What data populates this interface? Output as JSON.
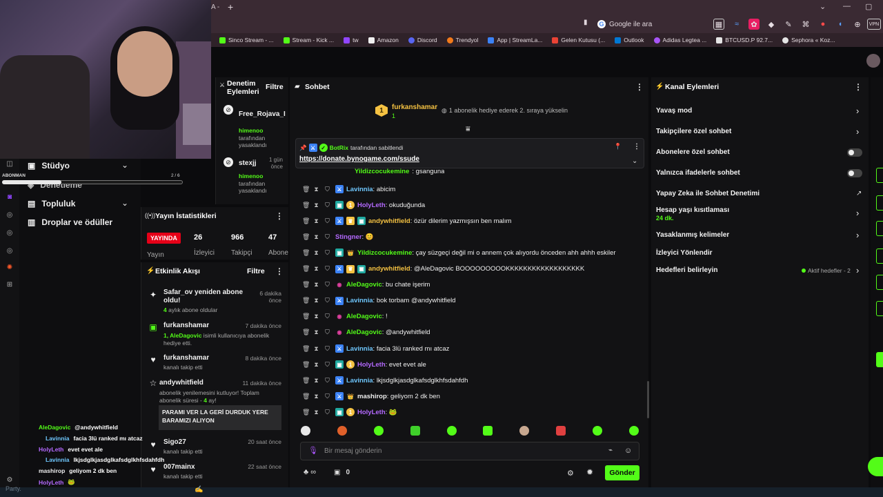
{
  "browser": {
    "tab_fragment": "A -",
    "new_tab": "+",
    "search_placeholder": "Google ile ara",
    "bookmarks": [
      {
        "label": "Sinco Stream - ...",
        "color": "#53fc18"
      },
      {
        "label": "Stream - Kick ...",
        "color": "#53fc18"
      },
      {
        "label": "tw",
        "color": "#9146ff"
      },
      {
        "label": "Amazon",
        "color": "#f0f0f0"
      },
      {
        "label": "Discord",
        "color": "#5865f2"
      },
      {
        "label": "Trendyol",
        "color": "#f27a1a"
      },
      {
        "label": "App | StreamLa...",
        "color": "#3b82f6"
      },
      {
        "label": "Gelen Kutusu (...",
        "color": "#ea4335"
      },
      {
        "label": "Outlook",
        "color": "#0078d4"
      },
      {
        "label": "Adidas Legtea ...",
        "color": "#a855f7"
      },
      {
        "label": "BTCUSD.P 92.7...",
        "color": "#e5e5e5"
      },
      {
        "label": "Sephora « Koz...",
        "color": "#e5e5e5"
      }
    ]
  },
  "sidebar": {
    "studio": "Stüdyo",
    "moderation": "Denetleme",
    "community": "Topluluk",
    "drops": "Droplar ve ödüller"
  },
  "sub_goal": {
    "label": "ABONMAN",
    "value": "2 / 6",
    "progress": 0.33
  },
  "mod_actions": {
    "title": "Denetim Eylemleri",
    "filter": "Filtre",
    "items": [
      {
        "user": "Free_Rojava_I",
        "by": "himenoo",
        "by_text": "tarafından yasaklandı",
        "time": ""
      },
      {
        "user": "stexjj",
        "by": "himenoo",
        "by_text": "tarafından yasaklandı",
        "time": "1 gün önce"
      }
    ]
  },
  "stats": {
    "title": "Yayın İstatistikleri",
    "live": "YAYINDA",
    "live_label": "Yayın",
    "viewers": "26",
    "viewers_label": "İzleyici",
    "followers": "966",
    "followers_label": "Takipçi",
    "subs": "47",
    "subs_label": "Abone"
  },
  "activity": {
    "title": "Etkinlik Akışı",
    "filter": "Filtre",
    "items": [
      {
        "icon": "✦",
        "title": "Safar_ov yeniden abone oldu!",
        "sub_b": "4",
        "sub": " aylık abone oldular",
        "time": "6 dakika önce"
      },
      {
        "icon": "▣",
        "title": "furkanshamar",
        "sub_b": "1, AleDagovic",
        "sub": " isimli kullanıcıya abonelik hediye etti.",
        "time": "7 dakika önce"
      },
      {
        "icon": "♥",
        "title": "furkanshamar",
        "sub_b": "",
        "sub": "kanalı takip etti",
        "time": "8 dakika önce"
      },
      {
        "icon": "☆",
        "title": "andywhitfield",
        "sub_b": "",
        "sub": "abonelik yenilemesini kutluyor! Toplam abonelik süresi - ",
        "sub_b2": "4",
        "sub2": " ay!",
        "time": "11 dakika önce"
      },
      {
        "icon": "♥",
        "title": "Sigo27",
        "sub_b": "",
        "sub": "kanalı takip etti",
        "time": "20 saat önce"
      },
      {
        "icon": "♥",
        "title": "007mainx",
        "sub_b": "",
        "sub": "kanalı takip etti",
        "time": "22 saat önce"
      }
    ],
    "quote": "PARAMI VER LA GERİ DURDUK YERE BARAMIZI ALIYON"
  },
  "chat": {
    "title": "Sohbet",
    "gift_user": "furkanshamar",
    "gift_count": "1",
    "gift_text": "1 abonelik hediye ederek 2. sıraya yükselin",
    "pinned_by": "BotRix",
    "pinned_text": "tarafından sabitlendi",
    "pinned_link": "https://donate.bynogame.com/ssude",
    "partial_user": "Yildizcocukemine",
    "partial_text": ": gsanguna",
    "messages": [
      {
        "user": "Lavinnia",
        "color": "#6fc8ff",
        "text": ": abicim"
      },
      {
        "user": "HolyLeth",
        "color": "#b469ff",
        "text": ": okuduğunda"
      },
      {
        "user": "andywhitfield",
        "color": "#f5c242",
        "text": ": özür dilerim yazmışsın ben malım"
      },
      {
        "user": "Stingner",
        "color": "#b469ff",
        "text": ": 😊"
      },
      {
        "user": "Yildizcocukemine",
        "color": "#53fc18",
        "text": ": çay süzgeçi değil mi o annem çok alıyordu önceden ahh ahhh eskiler"
      },
      {
        "user": "andywhitfield",
        "color": "#f5c242",
        "text": ": @AleDagovic BOOOOOOOOOKKKKKKKKKKKKKKKKKK"
      },
      {
        "user": "AleDagovic",
        "color": "#53fc18",
        "text": ": bu chate işerim"
      },
      {
        "user": "Lavinnia",
        "color": "#6fc8ff",
        "text": ": bok torbam @andywhitfield"
      },
      {
        "user": "AleDagovic",
        "color": "#53fc18",
        "text": ": !"
      },
      {
        "user": "AleDagovic",
        "color": "#53fc18",
        "text": ": @andywhitfield"
      },
      {
        "user": "Lavinnia",
        "color": "#6fc8ff",
        "text": ": facia 3lü ranked mı atcaz"
      },
      {
        "user": "HolyLeth",
        "color": "#b469ff",
        "text": ": evet evet ale"
      },
      {
        "user": "Lavinnia",
        "color": "#6fc8ff",
        "text": ": lkjsdglkjasdglkafsdglkhfsdahfdh"
      },
      {
        "user": "mashirop",
        "color": "#f0f0f0",
        "text": ": geliyom 2 dk ben"
      },
      {
        "user": "HolyLeth",
        "color": "#b469ff",
        "text": ": 🐸"
      }
    ],
    "input_placeholder": "Bir mesaj gönderin",
    "infinity": "∞",
    "count": "0",
    "send": "Gönder"
  },
  "channel": {
    "title": "Kanal Eylemleri",
    "slow": "Yavaş mod",
    "followers_only": "Takipçilere özel sohbet",
    "subs_only": "Abonelere özel sohbet",
    "emotes_only": "Yalnızca ifadelerle sohbet",
    "ai_mod": "Yapay Zeka ile Sohbet Denetimi",
    "account_age": "Hesap yaşı kısıtlaması",
    "account_age_val": "24 dk.",
    "banned_words": "Yasaklanmış kelimeler",
    "raid": "İzleyici Yönlendir",
    "goals": "Hedefleri belirleyin",
    "goals_active": "Aktif hedefler - 2"
  },
  "overlay_chat": [
    {
      "user": "AleDagovic",
      "color": "#53fc18",
      "text": "@andywhitfield"
    },
    {
      "user": "Lavinnia",
      "color": "#6fc8ff",
      "text": "facia 3lü ranked mı atcaz"
    },
    {
      "user": "HolyLeth",
      "color": "#b469ff",
      "text": "evet evet ale"
    },
    {
      "user": "Lavinnia",
      "color": "#6fc8ff",
      "text": "lkjsdglkjasdglkafsdglkhfsdahfdh"
    },
    {
      "user": "mashirop",
      "color": "#f0f0f0",
      "text": "geliyom 2 dk ben"
    },
    {
      "user": "HolyLeth",
      "color": "#b469ff",
      "text": "🐸"
    }
  ],
  "footer_fragment": "Party."
}
